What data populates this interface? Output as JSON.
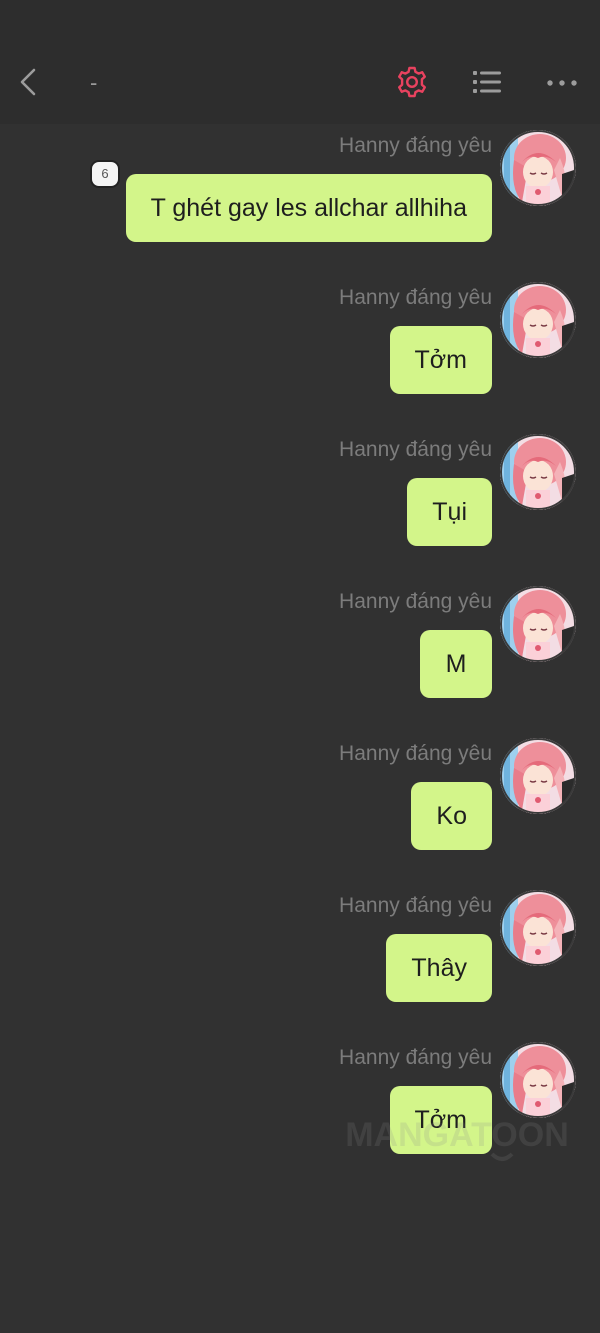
{
  "header": {
    "title": "-",
    "back_icon": "chevron-left-icon",
    "settings_icon": "gear-icon",
    "list_icon": "list-icon",
    "more_icon": "more-horizontal-icon",
    "accent_color": "#e8425f"
  },
  "messages": [
    {
      "sender": "Hanny đáng yêu",
      "text": "T ghét gay les allchar allhiha",
      "badge": "6"
    },
    {
      "sender": "Hanny đáng yêu",
      "text": "Tởm"
    },
    {
      "sender": "Hanny đáng yêu",
      "text": "Tụi"
    },
    {
      "sender": "Hanny đáng yêu",
      "text": "M"
    },
    {
      "sender": "Hanny đáng yêu",
      "text": "Ko"
    },
    {
      "sender": "Hanny đáng yêu",
      "text": "Thây"
    },
    {
      "sender": "Hanny đáng yêu",
      "text": "Tởm"
    }
  ],
  "watermark": "MANGATOON",
  "colors": {
    "background": "#313131",
    "bubble": "#d3f58a",
    "sender_text": "#7c7c7c"
  }
}
